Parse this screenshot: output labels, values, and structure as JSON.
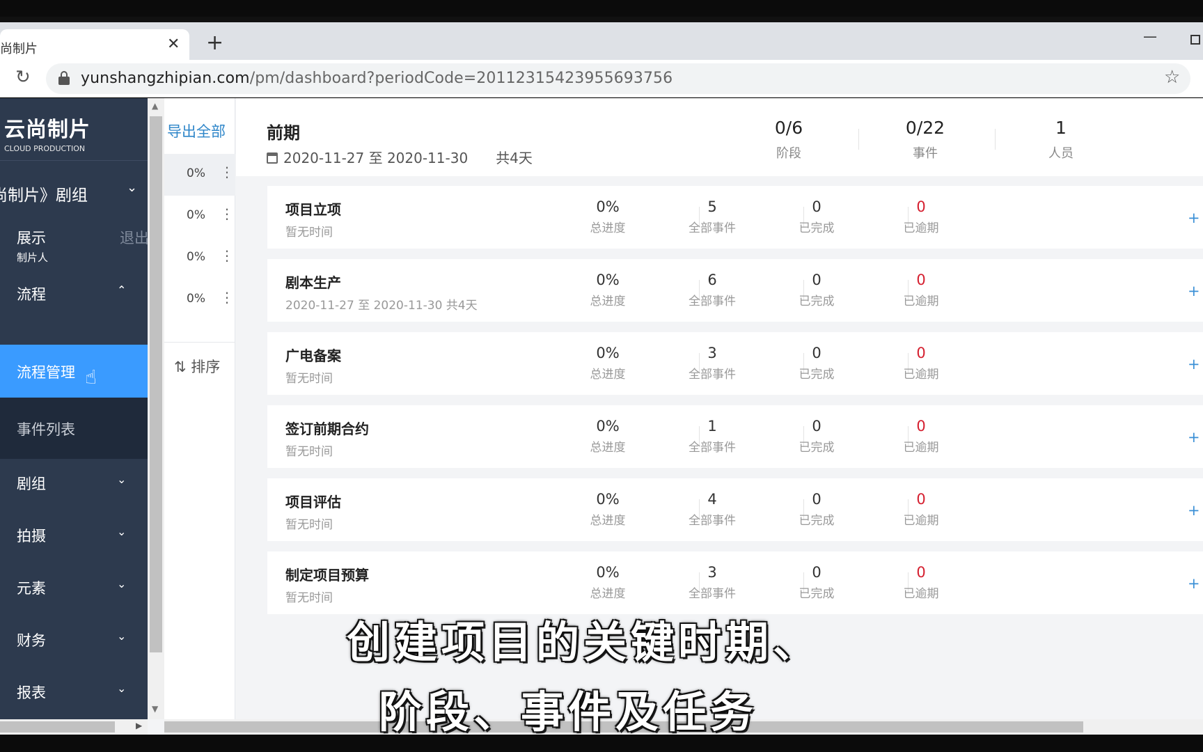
{
  "browser": {
    "tab_title": "云尚制片",
    "tab_close": "✕",
    "new_tab": "+",
    "url_host": "yunshangzhipian.com",
    "url_path": "/pm/dashboard?periodCode=20112315423955693756"
  },
  "sidebar": {
    "logo_cn": "云尚制片",
    "logo_en": "CLOUD PRODUCTION",
    "project": "《云尚制片》剧组",
    "user_name": "展示",
    "user_role": "制片人",
    "logout": "退出",
    "sections": [
      {
        "label": "流程",
        "arrow": "^"
      },
      {
        "label": "剧组",
        "arrow": "v"
      },
      {
        "label": "拍摄",
        "arrow": "v"
      },
      {
        "label": "元素",
        "arrow": "v"
      },
      {
        "label": "财务",
        "arrow": "v"
      },
      {
        "label": "报表",
        "arrow": "v"
      }
    ],
    "active_item": "流程管理",
    "sub_item": "事件列表"
  },
  "periods": {
    "export": "导出全部",
    "items": [
      {
        "pct": "0%"
      },
      {
        "pct": "0%"
      },
      {
        "pct": "0%"
      },
      {
        "pct": "0%"
      }
    ],
    "sort": "⇅ 排序"
  },
  "header": {
    "title": "前期",
    "dates": "2020-11-27 至 2020-11-30",
    "days": "共4天",
    "stats": [
      {
        "num": "0/6",
        "cap": "阶段"
      },
      {
        "num": "0/22",
        "cap": "事件"
      },
      {
        "num": "1",
        "cap": "人员"
      }
    ]
  },
  "stat_captions": {
    "progress": "总进度",
    "all": "全部事件",
    "done": "已完成",
    "overdue": "已逾期"
  },
  "new_label": "+ 新建",
  "stages": [
    {
      "name": "项目立项",
      "time": "暂无时间",
      "progress": "0%",
      "all": "5",
      "done": "0",
      "overdue": "0"
    },
    {
      "name": "剧本生产",
      "time": "2020-11-27 至 2020-11-30  共4天",
      "progress": "0%",
      "all": "6",
      "done": "0",
      "overdue": "0"
    },
    {
      "name": "广电备案",
      "time": "暂无时间",
      "progress": "0%",
      "all": "3",
      "done": "0",
      "overdue": "0"
    },
    {
      "name": "签订前期合约",
      "time": "暂无时间",
      "progress": "0%",
      "all": "1",
      "done": "0",
      "overdue": "0"
    },
    {
      "name": "项目评估",
      "time": "暂无时间",
      "progress": "0%",
      "all": "4",
      "done": "0",
      "overdue": "0"
    },
    {
      "name": "制定项目预算",
      "time": "暂无时间",
      "progress": "0%",
      "all": "3",
      "done": "0",
      "overdue": "0"
    }
  ],
  "subtitles": {
    "line1": "创建项目的关键时期、",
    "line2": "阶段、事件及任务"
  }
}
